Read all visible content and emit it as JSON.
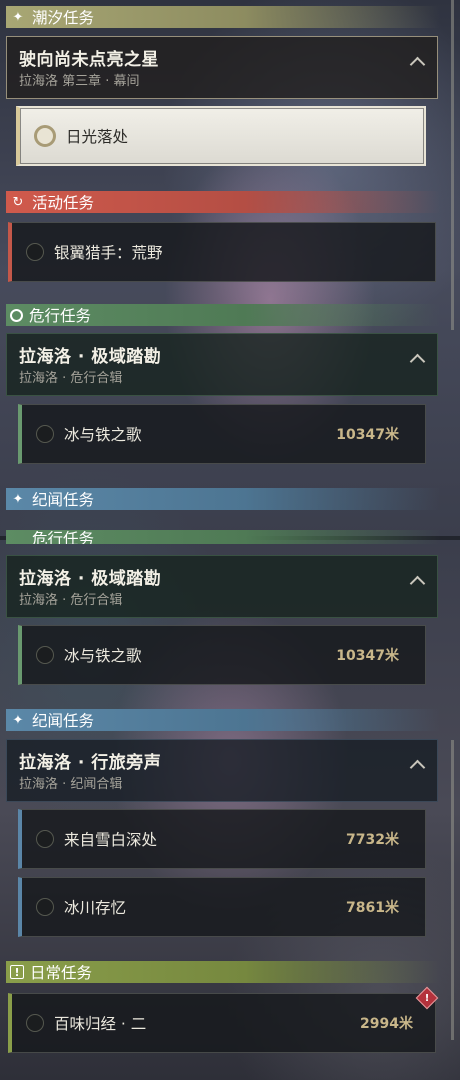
{
  "colors": {
    "tide": "#a8a774",
    "event": "#d05a4c",
    "peril": "#5d8c63",
    "chronicle": "#5b88a8",
    "daily": "#8a9e4a",
    "distance": "#c9b78a"
  },
  "icons": {
    "tide": "sparkle-icon",
    "event": "cycle-icon",
    "peril": "gear-icon",
    "chronicle": "sparkle-icon",
    "daily": "exclamation-icon"
  },
  "sections": {
    "tide": {
      "header": "潮汐任务",
      "group": {
        "title": "驶向尚未点亮之星",
        "subtitle": "拉海洛 第三章 · 幕间"
      },
      "item": {
        "name": "日光落处"
      }
    },
    "event": {
      "header": "活动任务",
      "item": {
        "name": "银翼猎手：荒野"
      }
    },
    "peril": {
      "header": "危行任务",
      "group": {
        "title": "拉海洛 · 极域踏勘",
        "subtitle": "拉海洛 · 危行合辑"
      },
      "item": {
        "name": "冰与铁之歌",
        "distance": "10347米"
      }
    },
    "chronicle": {
      "header": "纪闻任务",
      "group": {
        "title": "拉海洛 · 行旅旁声",
        "subtitle": "拉海洛 · 纪闻合辑"
      },
      "items": [
        {
          "name": "来自雪白深处",
          "distance": "7732米"
        },
        {
          "name": "冰川存忆",
          "distance": "7861米"
        }
      ]
    },
    "daily": {
      "header": "日常任务",
      "item": {
        "name": "百味归经 · 二",
        "distance": "2994米"
      }
    }
  },
  "repeat": {
    "peril_header": "危行任务"
  }
}
